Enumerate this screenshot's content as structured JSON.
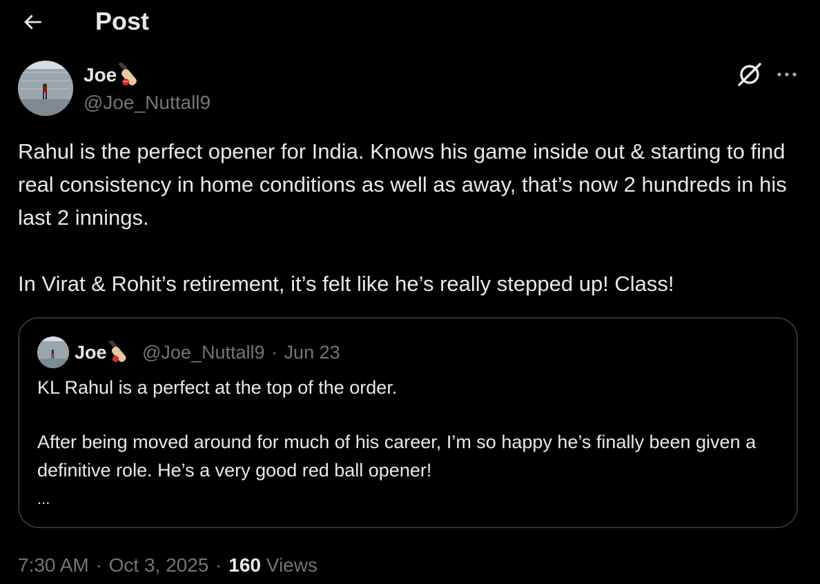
{
  "header": {
    "title": "Post",
    "back_icon": "arrow-left-icon"
  },
  "post": {
    "author": {
      "name": "Joe",
      "emoji_icon": "cricket-bat-icon",
      "handle": "@Joe_Nuttall9",
      "avatar_icon": "avatar-photo"
    },
    "actions": {
      "grok_icon": "grok-icon",
      "more_icon": "more-dots-icon"
    },
    "paragraphs": [
      "Rahul is the perfect opener for India. Knows his game inside out & starting to find real consistency in home conditions as well as away, that’s now 2 hundreds in his last 2 innings.",
      "In Virat & Rohit’s retirement, it’s felt like he’s really stepped up! Class!"
    ],
    "quote": {
      "name": "Joe",
      "handle": "@Joe_Nuttall9",
      "separator": "·",
      "date": "Jun 23",
      "paragraphs": [
        "KL Rahul is a perfect at the top of the order.",
        "After being moved around for much of his career, I’m so happy he’s finally been given a definitive role. He’s a very good red ball opener!"
      ],
      "ellipsis": "..."
    },
    "meta": {
      "time": "7:30 AM",
      "separator": "·",
      "date": "Oct 3, 2025",
      "views_count": "160",
      "views_label": "Views"
    }
  },
  "colors": {
    "background": "#000000",
    "text_primary": "#e7e9ea",
    "text_secondary": "#71767b",
    "border": "#2f3336"
  }
}
